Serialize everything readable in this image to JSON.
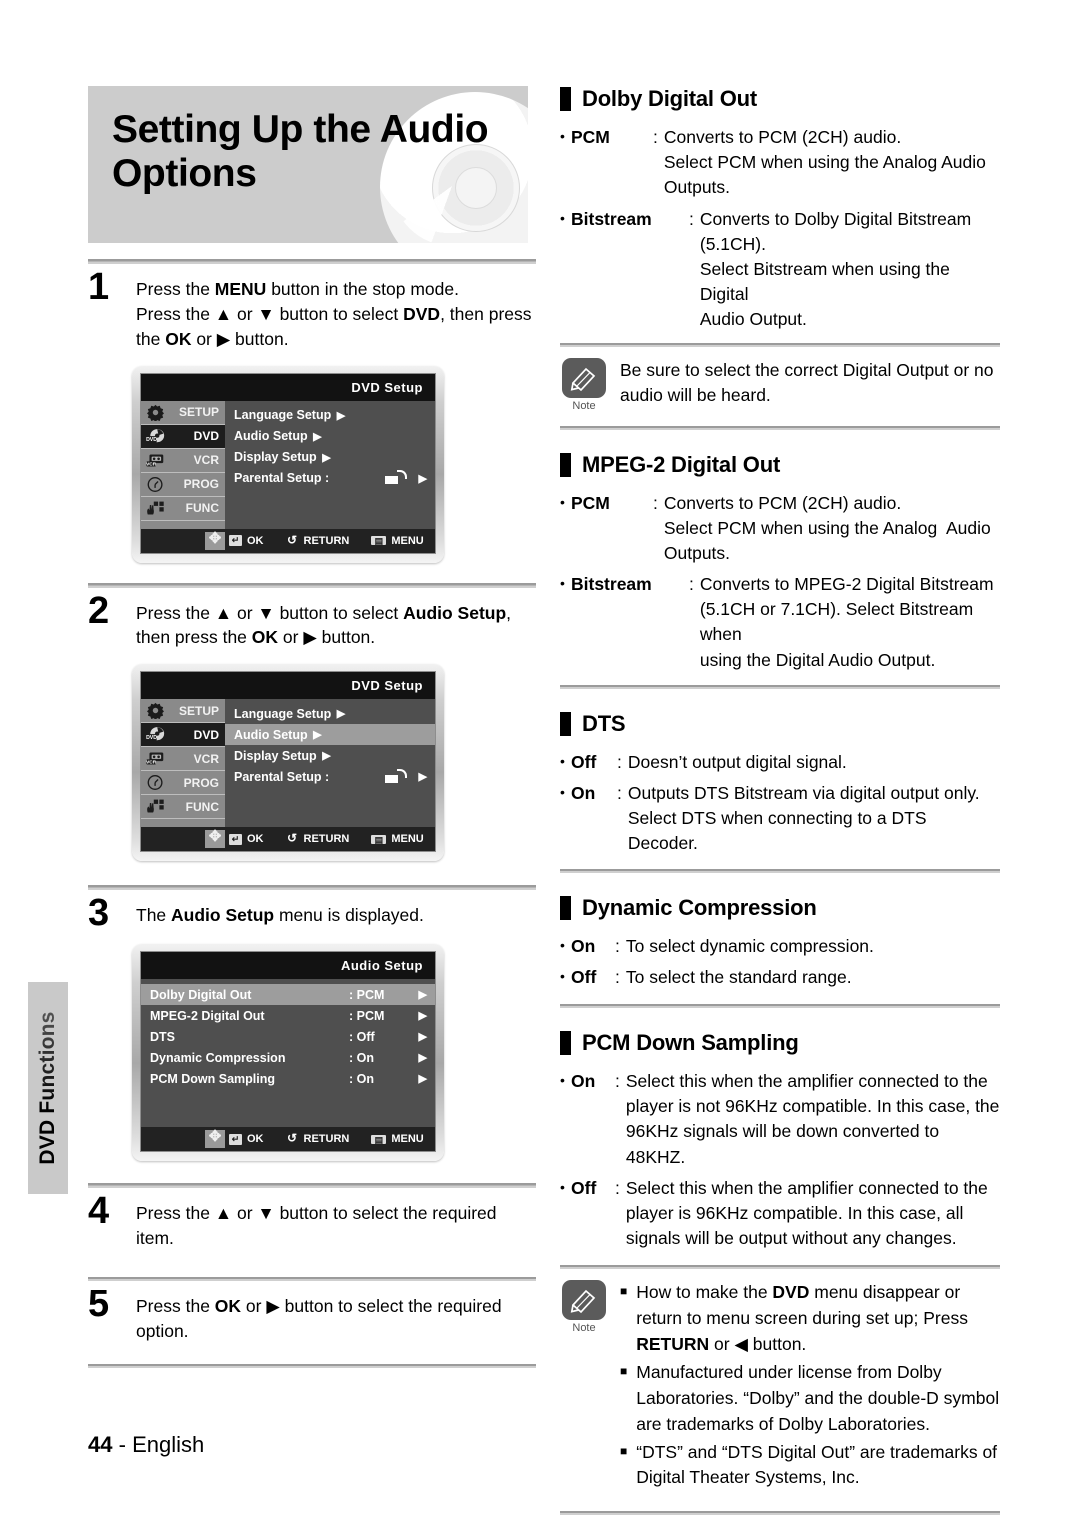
{
  "side_tab": {
    "label": "DVD Functions"
  },
  "header": {
    "title_line1": "Setting Up the Audio",
    "title_line2": "Options",
    "disc_icon": "dvd-disc-icon"
  },
  "footer": {
    "page": "44",
    "separator": "-",
    "language": "English"
  },
  "steps": [
    {
      "number": "1",
      "lines": [
        "Press the MENU button in the stop mode.",
        "Press the ▲ or ▼ button to select DVD, then press",
        "the OK or ▶ button."
      ]
    },
    {
      "number": "2",
      "lines": [
        "Press the ▲ or ▼ button to select Audio Setup,",
        "then press the OK or ▶ button."
      ]
    },
    {
      "number": "3",
      "lines": [
        "The Audio Setup menu is displayed."
      ]
    },
    {
      "number": "4",
      "lines": [
        "Press the ▲ or ▼ button to select the required item."
      ]
    },
    {
      "number": "5",
      "lines": [
        "Press the OK or ▶ button to select the required",
        "option."
      ]
    }
  ],
  "osd_sidebar": [
    {
      "label": "SETUP",
      "icon": "gear-icon",
      "active": false
    },
    {
      "label": "DVD",
      "icon": "dvd-icon",
      "active": true
    },
    {
      "label": "VCR",
      "icon": "vcr-icon",
      "active": false
    },
    {
      "label": "PROG",
      "icon": "clock-icon",
      "active": false
    },
    {
      "label": "FUNC",
      "icon": "hand-icon",
      "active": false
    }
  ],
  "osd_footer": {
    "nav_icon": "dpad-icon",
    "ok_icon": "ok-icon",
    "ok_label": "OK",
    "return_icon": "return-icon",
    "return_label": "RETURN",
    "menu_icon": "menu-icon",
    "menu_label": "MENU"
  },
  "osd_dvd_setup": {
    "title": "DVD  Setup",
    "rows": [
      {
        "label": "Language Setup",
        "value": "",
        "arrow": "▶",
        "selected": false,
        "lock": false
      },
      {
        "label": "Audio Setup",
        "value": "",
        "arrow": "▶",
        "selected": false,
        "lock": false
      },
      {
        "label": "Display Setup",
        "value": "",
        "arrow": "▶",
        "selected": false,
        "lock": false
      },
      {
        "label": "Parental Setup :",
        "value": "",
        "arrow": "▶",
        "selected": false,
        "lock": true
      }
    ]
  },
  "osd_dvd_setup_audio_selected": {
    "title": "DVD  Setup",
    "rows": [
      {
        "label": "Language Setup",
        "value": "",
        "arrow": "▶",
        "selected": false,
        "lock": false
      },
      {
        "label": "Audio Setup",
        "value": "",
        "arrow": "▶",
        "selected": true,
        "lock": false
      },
      {
        "label": "Display Setup",
        "value": "",
        "arrow": "▶",
        "selected": false,
        "lock": false
      },
      {
        "label": "Parental Setup :",
        "value": "",
        "arrow": "▶",
        "selected": false,
        "lock": true
      }
    ]
  },
  "osd_audio_setup": {
    "title": "Audio Setup",
    "rows": [
      {
        "label": "Dolby Digital Out",
        "value": ": PCM",
        "arrow": "▶",
        "selected": true,
        "lock": false
      },
      {
        "label": "MPEG-2 Digital Out",
        "value": ": PCM",
        "arrow": "▶",
        "selected": false,
        "lock": false
      },
      {
        "label": "DTS",
        "value": ": Off",
        "arrow": "▶",
        "selected": false,
        "lock": false
      },
      {
        "label": "Dynamic Compression",
        "value": ": On",
        "arrow": "▶",
        "selected": false,
        "lock": false
      },
      {
        "label": "PCM Down Sampling",
        "value": ": On",
        "arrow": "▶",
        "selected": false,
        "lock": false
      }
    ]
  },
  "sections": {
    "dolby": {
      "heading": "Dolby Digital Out",
      "defs": [
        {
          "term": "PCM",
          "desc": "Converts to PCM (2CH) audio.\nSelect PCM when using the Analog Audio\nOutputs."
        },
        {
          "term": "Bitstream",
          "desc": "Converts to Dolby Digital Bitstream (5.1CH).\nSelect Bitstream when using the Digital\nAudio Output."
        }
      ],
      "note": {
        "caption": "Note",
        "icon": "pencil-icon",
        "text": "Be sure to select the correct Digital Output or no audio will be heard."
      }
    },
    "mpeg2": {
      "heading": "MPEG-2 Digital Out",
      "defs": [
        {
          "term": "PCM",
          "desc": "Converts to PCM (2CH) audio.\nSelect PCM when using the Analog  Audio\nOutputs."
        },
        {
          "term": "Bitstream",
          "desc": "Converts to MPEG-2 Digital Bitstream\n(5.1CH or 7.1CH). Select Bitstream when\nusing the Digital Audio Output."
        }
      ]
    },
    "dts": {
      "heading": "DTS",
      "defs": [
        {
          "term": "Off",
          "desc": "Doesn’t output digital signal."
        },
        {
          "term": "On",
          "desc": "Outputs DTS Bitstream via digital output only.\nSelect DTS when connecting to a DTS Decoder."
        }
      ]
    },
    "dynamic": {
      "heading": "Dynamic Compression",
      "defs": [
        {
          "term": "On",
          "desc": "To select dynamic compression."
        },
        {
          "term": "Off",
          "desc": "To select the standard range."
        }
      ]
    },
    "pcmdown": {
      "heading": "PCM Down Sampling",
      "defs": [
        {
          "term": "On",
          "desc": "Select this when the amplifier connected to the\nplayer is not 96KHz compatible. In this case, the\n96KHz signals will be down converted to 48KHZ."
        },
        {
          "term": "Off",
          "desc": "Select this when the amplifier connected to the\nplayer is 96KHz compatible. In this case, all\nsignals will be output without any changes."
        }
      ]
    },
    "bottom_note": {
      "caption": "Note",
      "icon": "pencil-icon",
      "items": [
        "How to make the DVD menu disappear or return to menu screen during set up; Press RETURN or ◀ button.",
        "Manufactured under license from Dolby Laboratories. “Dolby” and the double-D symbol are trademarks of Dolby Laboratories.",
        "“DTS” and “DTS Digital Out” are trademarks of Digital Theater Systems, Inc."
      ]
    }
  }
}
